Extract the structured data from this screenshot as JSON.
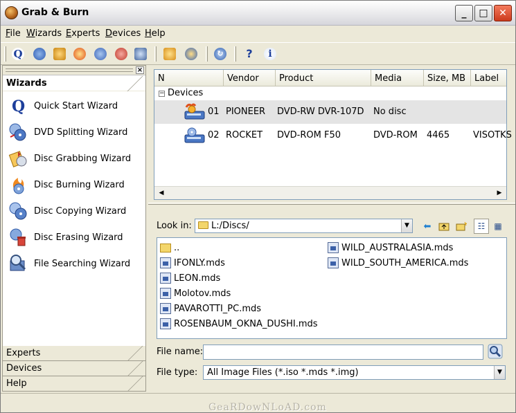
{
  "window": {
    "title": "Grab & Burn"
  },
  "menu": [
    "File",
    "Wizards",
    "Experts",
    "Devices",
    "Help"
  ],
  "toolbar": {
    "buttons": [
      "quick-start-icon",
      "dvd-splitting-icon",
      "disc-grabbing-icon",
      "disc-burning-icon",
      "disc-copying-icon",
      "disc-erasing-icon",
      "file-search-icon",
      "grab-icon",
      "burn-icon",
      "refresh-icon",
      "help-icon",
      "info-icon"
    ]
  },
  "left_pane": {
    "active_section": "Wizards",
    "wizards": [
      {
        "label": "Quick Start Wizard",
        "icon": "quick-start-icon"
      },
      {
        "label": "DVD Splitting Wizard",
        "icon": "dvd-splitting-icon"
      },
      {
        "label": "Disc Grabbing Wizard",
        "icon": "disc-grabbing-icon"
      },
      {
        "label": "Disc Burning Wizard",
        "icon": "disc-burning-icon"
      },
      {
        "label": "Disc Copying Wizard",
        "icon": "disc-copying-icon"
      },
      {
        "label": "Disc Erasing Wizard",
        "icon": "disc-erasing-icon"
      },
      {
        "label": "File Searching Wizard",
        "icon": "file-search-icon"
      }
    ],
    "sections": [
      "Experts",
      "Devices",
      "Help"
    ]
  },
  "devices": {
    "columns": [
      "N",
      "Vendor",
      "Product",
      "Media",
      "Size, MB",
      "Label"
    ],
    "root": "Devices",
    "rows": [
      {
        "n": "01",
        "vendor": "PIONEER",
        "product": "DVD-RW  DVR-107D",
        "media": "No disc",
        "size": "",
        "label": ""
      },
      {
        "n": "02",
        "vendor": "ROCKET",
        "product": "DVD-ROM F50",
        "media": "DVD-ROM",
        "size": "4465",
        "label": "VISOTKS"
      }
    ]
  },
  "browser": {
    "look_in_label": "Look in:",
    "look_in_value": "L:/Discs/",
    "files_col1": [
      "..",
      "IFONLY.mds",
      "LEON.mds",
      "Molotov.mds",
      "PAVAROTTI_PC.mds",
      "ROSENBAUM_OKNA_DUSHI.mds"
    ],
    "files_col2": [
      "WILD_AUSTRALASIA.mds",
      "WILD_SOUTH_AMERICA.mds"
    ],
    "file_name_label": "File name:",
    "file_name_value": "",
    "file_type_label": "File type:",
    "file_type_value": "All Image Files (*.iso *.mds *.img)"
  },
  "watermark": "GeaRDowNLoAD.com",
  "colors": {
    "selection": "#e4e4e4",
    "border": "#7f9db9",
    "chrome": "#ece9d8"
  }
}
